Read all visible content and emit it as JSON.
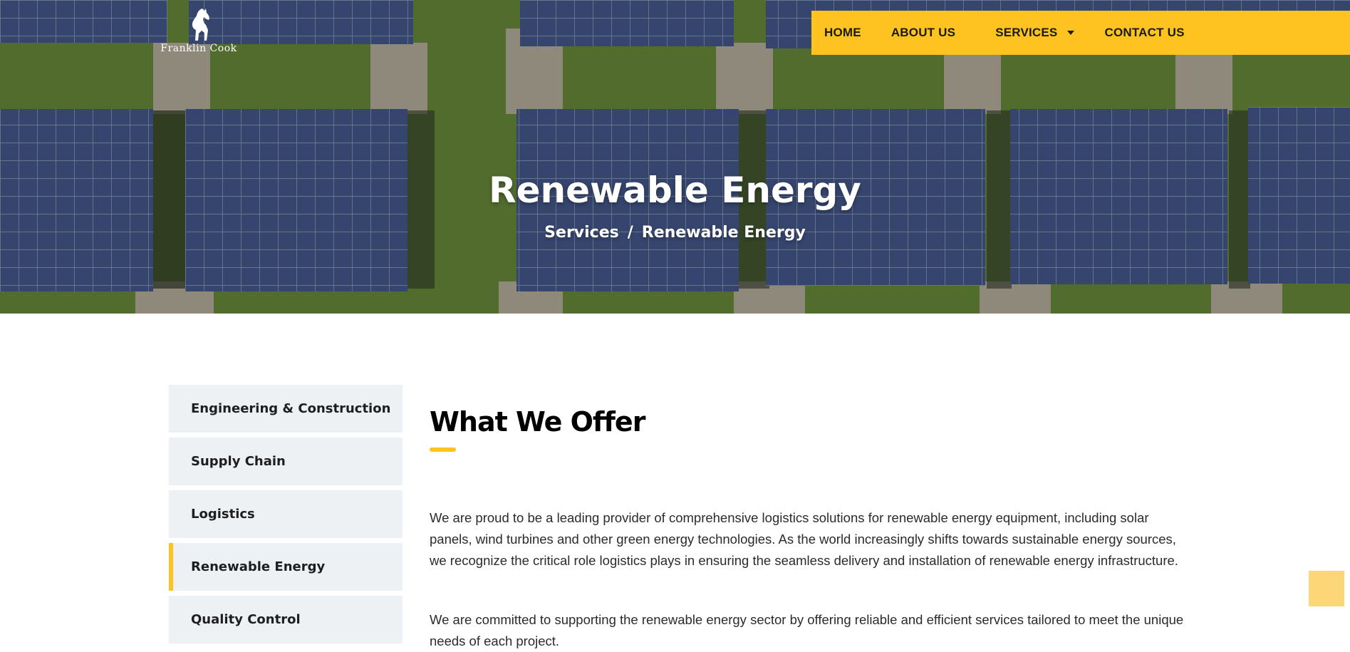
{
  "brand": {
    "logo_text": "Franklin Cook"
  },
  "nav": {
    "items": [
      {
        "label": "HOME"
      },
      {
        "label": "ABOUT US"
      },
      {
        "label": "SERVICES"
      },
      {
        "label": "CONTACT US"
      }
    ]
  },
  "hero": {
    "title": "Renewable Energy",
    "breadcrumb": {
      "parent": "Services",
      "separator": "/",
      "current": "Renewable Energy"
    }
  },
  "sidebar": {
    "items": [
      {
        "label": "Engineering & Construction",
        "active": false
      },
      {
        "label": "Supply Chain",
        "active": false
      },
      {
        "label": "Logistics",
        "active": false
      },
      {
        "label": "Renewable Energy",
        "active": true
      },
      {
        "label": "Quality Control",
        "active": false
      }
    ]
  },
  "main": {
    "heading": "What We Offer",
    "paragraphs": [
      "We are proud to be a leading provider of comprehensive logistics solutions for renewable energy equipment, including solar panels, wind turbines and other green energy technologies. As the world increasingly shifts towards sustainable energy sources, we recognize the critical role logistics plays in ensuring the seamless delivery and installation of renewable energy infrastructure.",
      "We are committed to supporting the renewable energy sector by offering reliable and efficient services tailored to meet the unique needs of each project."
    ]
  },
  "colors": {
    "accent": "#fec321",
    "sidebar_bg": "#eef1f4",
    "scroll_top": "#fdd777"
  },
  "icons": {
    "logo": "horse-icon",
    "dropdown": "caret-down-icon",
    "back_to_top": "scroll-top-icon"
  }
}
